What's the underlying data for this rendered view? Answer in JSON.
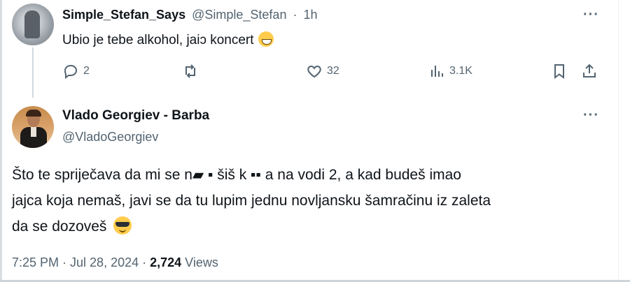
{
  "reply": {
    "display_name": "Simple_Stefan_Says",
    "handle": "@Simple_Stefan",
    "separator": "·",
    "time": "1h",
    "text": "Ubio je tebe alkohol, jaiↄ koncert",
    "emoji": "grinning-face",
    "actions": {
      "replies": "2",
      "retweets": "",
      "likes": "32",
      "views": "3.1K"
    }
  },
  "tweet": {
    "display_name": "Vlado Georgiev - Barba",
    "handle": "@VladoGeorgiev",
    "text_lines": [
      "Što te spriječava da mi se n▰ ▪ šiš k ▪▪ a na vodi 2, a kad budeš imao",
      "jajca koja nemaš, javi se da tu lupim jednu novljansku šamračinu iz zaleta",
      "da se dozoveš"
    ],
    "emoji": "smiling-face-with-sunglasses",
    "timestamp": "7:25 PM · Jul 28, 2024 · ",
    "views_count": "2,724",
    "views_label": " Views"
  },
  "more_label": "···",
  "colors": {
    "text": "#0f1419",
    "secondary": "#536471",
    "thread_line": "#cfd9de"
  }
}
